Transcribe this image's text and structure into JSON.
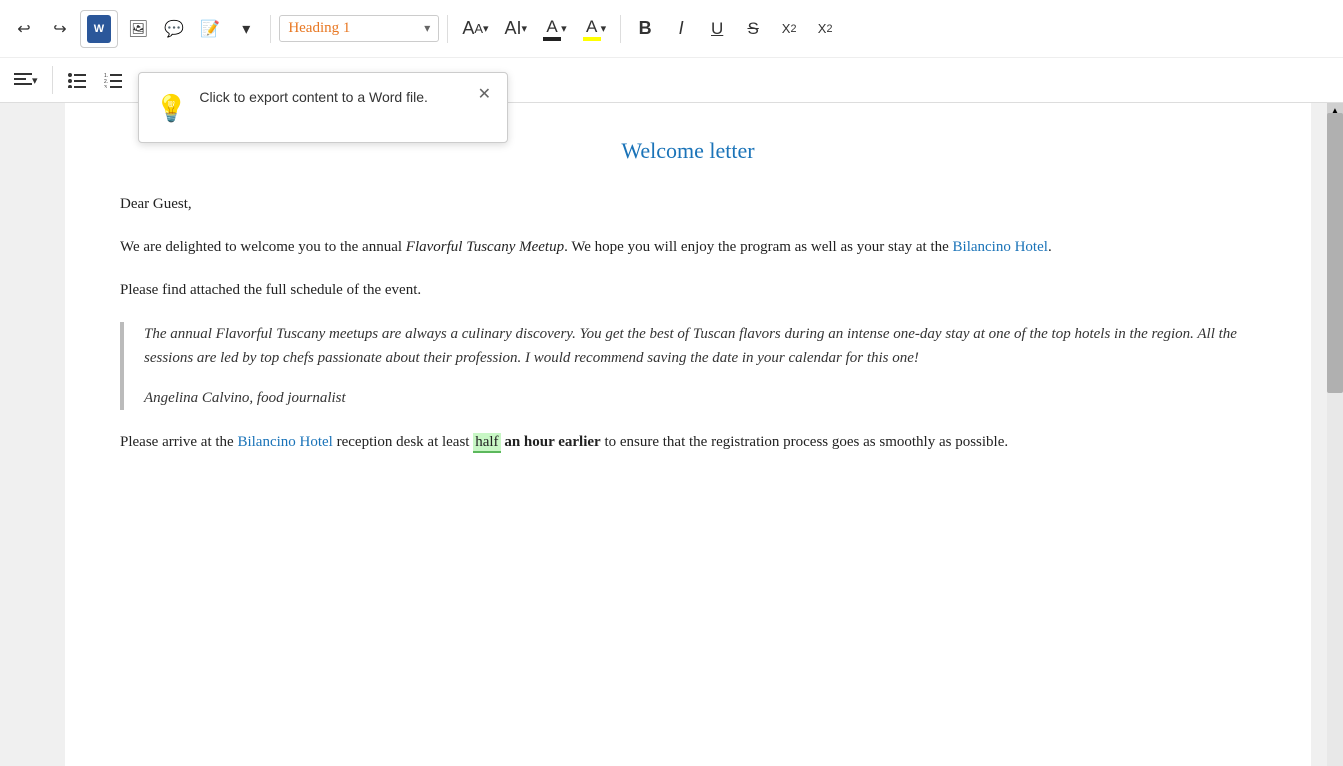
{
  "toolbar": {
    "undo_label": "↩",
    "redo_label": "↪",
    "word_export_label": "W",
    "insert_comment_label": "💬",
    "track_changes_label": "📝",
    "more_label": "▾",
    "heading_select_value": "Heading 1",
    "heading_select_chevron": "▾",
    "font_size_auto": "A",
    "font_size_auto_small": "A",
    "font_color_label": "A",
    "highlight_label": "A",
    "bold_label": "B",
    "italic_label": "I",
    "underline_label": "U",
    "strikethrough_label": "S",
    "subscript_label": "X₂",
    "superscript_label": "X²",
    "align_left_label": "≡",
    "align_chevron": "▾",
    "bullet_list_label": "≡",
    "numbered_list_label": "≡",
    "decrease_indent_label": "≡",
    "increase_indent_label": "≡"
  },
  "tooltip": {
    "icon": "💡",
    "text": "Click to export content to a Word file.",
    "close_label": "✕"
  },
  "document": {
    "title": "Welcome letter",
    "para1": "Dear Guest,",
    "para2_before": "We are delighted to welcome you to the annual ",
    "para2_italic": "Flavorful Tuscany Meetup",
    "para2_after": ". We hope you will enjoy the program as well as your stay at the ",
    "para2_link": "Bilancino Hotel",
    "para2_end": ".",
    "para3": "Please find attached the full schedule of the event.",
    "blockquote_text": "The annual Flavorful Tuscany meetups are always a culinary discovery. You get the best of Tuscan flavors during an intense one-day stay at one of the top hotels in the region. All the sessions are led by top chefs passionate about their profession. I would recommend saving the date in your calendar for this one!",
    "blockquote_attribution": "Angelina Calvino, food journalist",
    "para4_before": "Please arrive at the ",
    "para4_link1": "Bilancino Hotel",
    "para4_middle": " reception desk at least ",
    "para4_highlight": "half",
    "para4_bold": " an hour earlier",
    "para4_after": " to ensure that the registration process goes as smoothly as possible.",
    "link_color": "#1a73b8"
  }
}
